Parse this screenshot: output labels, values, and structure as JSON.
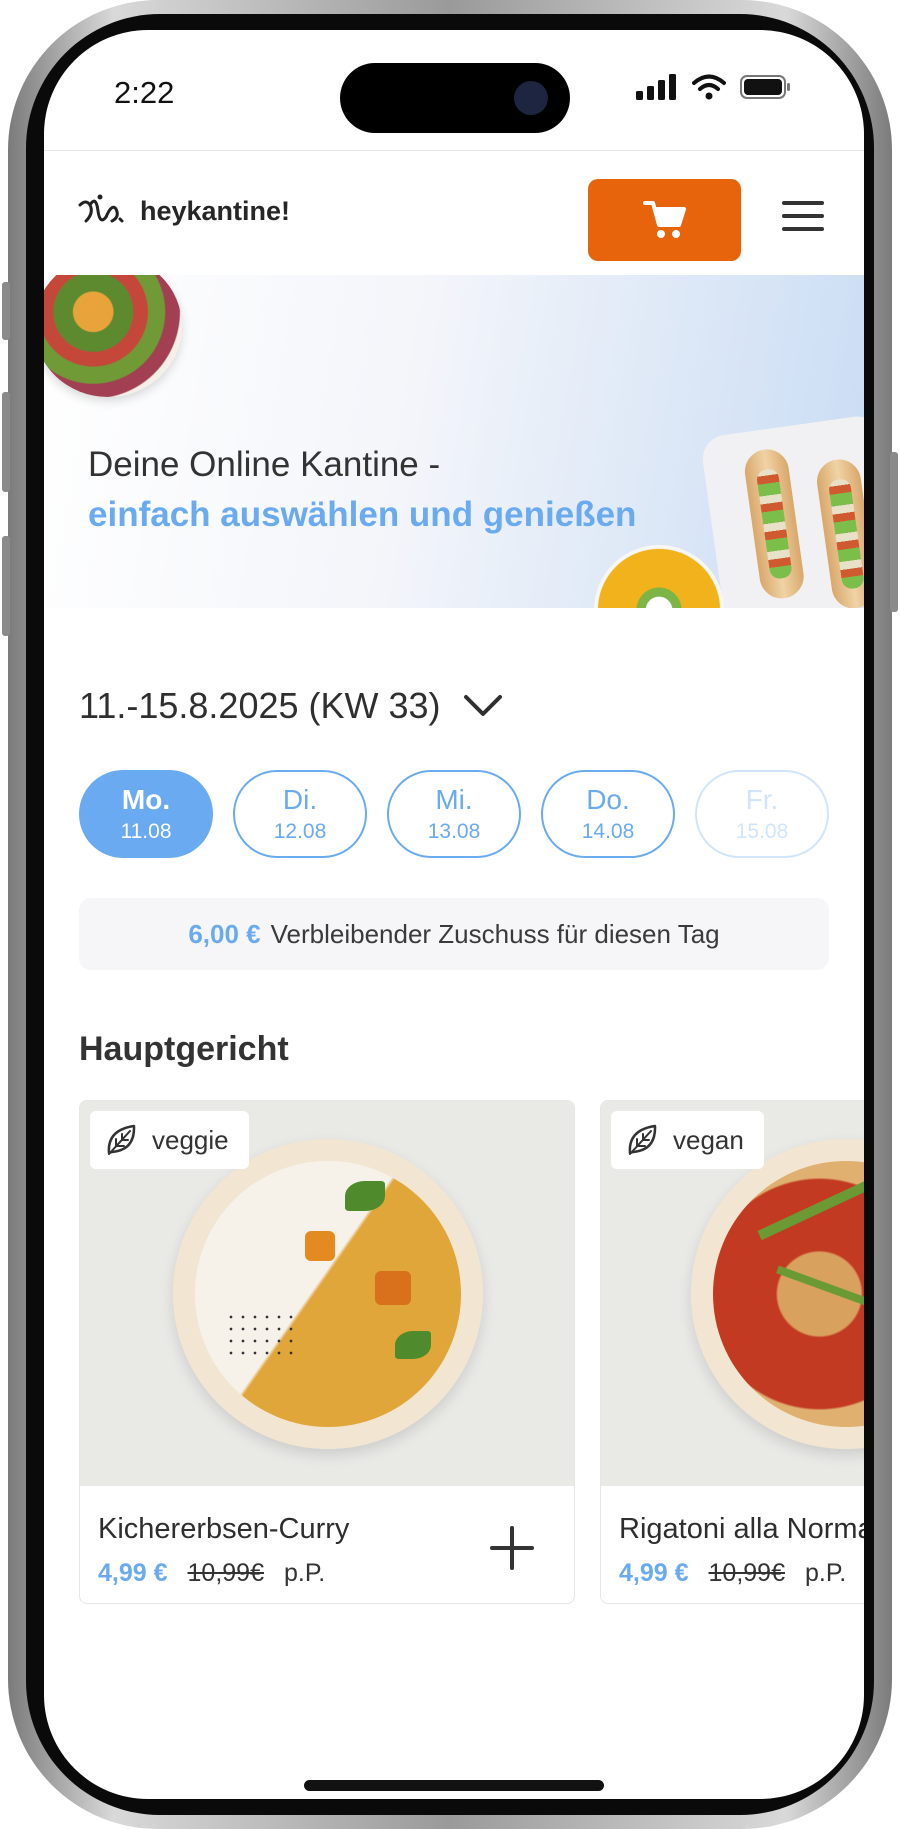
{
  "status": {
    "time": "2:22"
  },
  "header": {
    "logo_text": "heykantine!",
    "cart_icon": "cart-icon",
    "menu_icon": "hamburger-menu-icon"
  },
  "hero": {
    "line1": "Deine Online Kantine -",
    "line2": "einfach auswählen und genießen"
  },
  "week": {
    "label": "11.-15.8.2025 (KW 33)",
    "dropdown_icon": "chevron-down-icon"
  },
  "days": [
    {
      "day": "Mo.",
      "date": "11.08",
      "selected": true
    },
    {
      "day": "Di.",
      "date": "12.08",
      "selected": false
    },
    {
      "day": "Mi.",
      "date": "13.08",
      "selected": false
    },
    {
      "day": "Do.",
      "date": "14.08",
      "selected": false
    },
    {
      "day": "Fr.",
      "date": "15.08",
      "selected": false
    }
  ],
  "subsidy": {
    "amount": "6,00 €",
    "text": "Verbleibender Zuschuss für diesen Tag"
  },
  "section": {
    "title": "Hauptgericht"
  },
  "products": [
    {
      "badge": "veggie",
      "name": "Kichererbsen-Curry",
      "price": "4,99 €",
      "old_price": "10,99€",
      "unit": "p.P."
    },
    {
      "badge": "vegan",
      "name": "Rigatoni alla Norma",
      "price": "4,99 €",
      "old_price": "10,99€",
      "unit": "p.P."
    }
  ],
  "colors": {
    "accent": "#6aaaf0",
    "cart": "#e8640c"
  }
}
